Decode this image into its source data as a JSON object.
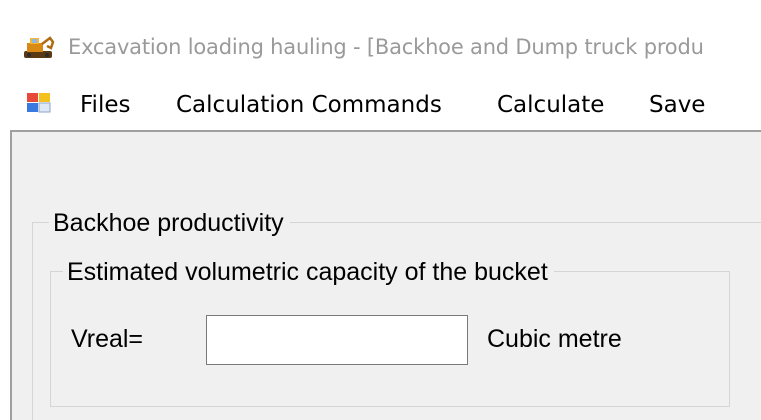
{
  "window": {
    "title": "Excavation loading hauling - [Backhoe and Dump truck produ",
    "app_icon": "excavator-icon"
  },
  "menubar": {
    "menu_icon": "mdi-child-window-icon",
    "items": [
      {
        "label": "Files"
      },
      {
        "label": "Calculation Commands"
      },
      {
        "label": "Calculate"
      },
      {
        "label": "Save"
      }
    ]
  },
  "form": {
    "group_title": "Backhoe productivity",
    "subgroup_title": "Estimated volumetric capacity of the bucket",
    "field_label": "Vreal=",
    "field_value": "",
    "unit": "Cubic metre"
  },
  "colors": {
    "title_text": "#9a9a9a",
    "client_background": "#f0f0f0",
    "group_border": "#d5d5d5"
  }
}
